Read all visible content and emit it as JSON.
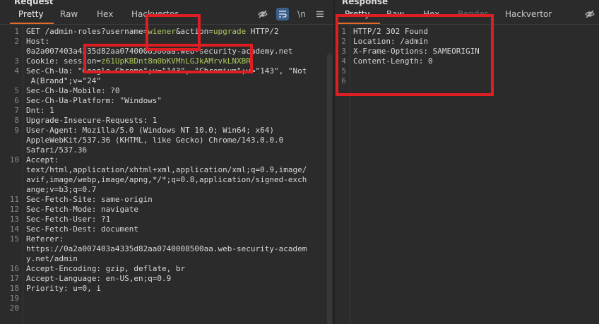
{
  "request": {
    "title": "Request",
    "tabs": [
      {
        "label": "Pretty",
        "active": true
      },
      {
        "label": "Raw",
        "active": false
      },
      {
        "label": "Hex",
        "active": false
      },
      {
        "label": "Hackvertor",
        "active": false
      }
    ],
    "toolbar": {
      "newline_label": "\\n"
    },
    "lines": [
      {
        "n": "1",
        "segs": [
          {
            "t": "GET /admin-roles?username="
          },
          {
            "t": "wiener",
            "h": true
          },
          {
            "t": "&action="
          },
          {
            "t": "upgrade",
            "h": true
          },
          {
            "t": " HTTP/2"
          }
        ]
      },
      {
        "n": "2",
        "segs": [
          {
            "t": "Host:"
          }
        ]
      },
      {
        "n": "",
        "segs": [
          {
            "t": "0a2a007403a4335d82aa0740008500aa.web-security-academy.net"
          }
        ]
      },
      {
        "n": "3",
        "segs": [
          {
            "t": "Cookie: session="
          },
          {
            "t": "z61UpKBDnt8m0bKVMhLGJkAMrvkLNXBR",
            "h": true
          }
        ]
      },
      {
        "n": "4",
        "segs": [
          {
            "t": "Sec-Ch-Ua: \"Google Chrome\";v=\"143\", \"Chromium\";v=\"143\", \"Not"
          }
        ]
      },
      {
        "n": "",
        "segs": [
          {
            "t": " A(Brand\";v=\"24\""
          }
        ]
      },
      {
        "n": "5",
        "segs": [
          {
            "t": "Sec-Ch-Ua-Mobile: ?0"
          }
        ]
      },
      {
        "n": "6",
        "segs": [
          {
            "t": "Sec-Ch-Ua-Platform: \"Windows\""
          }
        ]
      },
      {
        "n": "7",
        "segs": [
          {
            "t": "Dnt: 1"
          }
        ]
      },
      {
        "n": "8",
        "segs": [
          {
            "t": "Upgrade-Insecure-Requests: 1"
          }
        ]
      },
      {
        "n": "9",
        "segs": [
          {
            "t": "User-Agent: Mozilla/5.0 (Windows NT 10.0; Win64; x64)"
          }
        ]
      },
      {
        "n": "",
        "segs": [
          {
            "t": "AppleWebKit/537.36 (KHTML, like Gecko) Chrome/143.0.0.0"
          }
        ]
      },
      {
        "n": "",
        "segs": [
          {
            "t": "Safari/537.36"
          }
        ]
      },
      {
        "n": "10",
        "segs": [
          {
            "t": "Accept:"
          }
        ]
      },
      {
        "n": "",
        "segs": [
          {
            "t": "text/html,application/xhtml+xml,application/xml;q=0.9,image/"
          }
        ]
      },
      {
        "n": "",
        "segs": [
          {
            "t": "avif,image/webp,image/apng,*/*;q=0.8,application/signed-exch"
          }
        ]
      },
      {
        "n": "",
        "segs": [
          {
            "t": "ange;v=b3;q=0.7"
          }
        ]
      },
      {
        "n": "11",
        "segs": [
          {
            "t": "Sec-Fetch-Site: same-origin"
          }
        ]
      },
      {
        "n": "12",
        "segs": [
          {
            "t": "Sec-Fetch-Mode: navigate"
          }
        ]
      },
      {
        "n": "13",
        "segs": [
          {
            "t": "Sec-Fetch-User: ?1"
          }
        ]
      },
      {
        "n": "14",
        "segs": [
          {
            "t": "Sec-Fetch-Dest: document"
          }
        ]
      },
      {
        "n": "15",
        "segs": [
          {
            "t": "Referer:"
          }
        ]
      },
      {
        "n": "",
        "segs": [
          {
            "t": "https://0a2a007403a4335d82aa0740008500aa.web-security-academ"
          }
        ]
      },
      {
        "n": "",
        "segs": [
          {
            "t": "y.net/admin"
          }
        ]
      },
      {
        "n": "16",
        "segs": [
          {
            "t": "Accept-Encoding: gzip, deflate, br"
          }
        ]
      },
      {
        "n": "17",
        "segs": [
          {
            "t": "Accept-Language: en-US,en;q=0.9"
          }
        ]
      },
      {
        "n": "18",
        "segs": [
          {
            "t": "Priority: u=0, i"
          }
        ]
      },
      {
        "n": "19",
        "segs": []
      },
      {
        "n": "20",
        "segs": []
      }
    ]
  },
  "response": {
    "title": "Response",
    "tabs": [
      {
        "label": "Pretty",
        "active": true
      },
      {
        "label": "Raw",
        "active": false
      },
      {
        "label": "Hex",
        "active": false
      },
      {
        "label": "Render",
        "active": false,
        "disabled": true
      },
      {
        "label": "Hackvertor",
        "active": false
      }
    ],
    "lines": [
      {
        "n": "1",
        "segs": [
          {
            "t": "HTTP/2 302 Found"
          }
        ]
      },
      {
        "n": "2",
        "segs": [
          {
            "t": "Location: /admin"
          }
        ]
      },
      {
        "n": "3",
        "segs": [
          {
            "t": "X-Frame-Options: SAMEORIGIN"
          }
        ]
      },
      {
        "n": "4",
        "segs": [
          {
            "t": "Content-Length: 0"
          }
        ]
      },
      {
        "n": "5",
        "segs": []
      },
      {
        "n": "6",
        "segs": []
      }
    ]
  },
  "icons": {
    "hide": "eye-slash-icon",
    "wrap": "word-wrap-icon",
    "menu": "hamburger-menu-icon"
  },
  "colors": {
    "background": "#2b2b2b",
    "accent": "#e36b2c",
    "highlight": "#aac95c",
    "annotation": "#dd1f23"
  }
}
